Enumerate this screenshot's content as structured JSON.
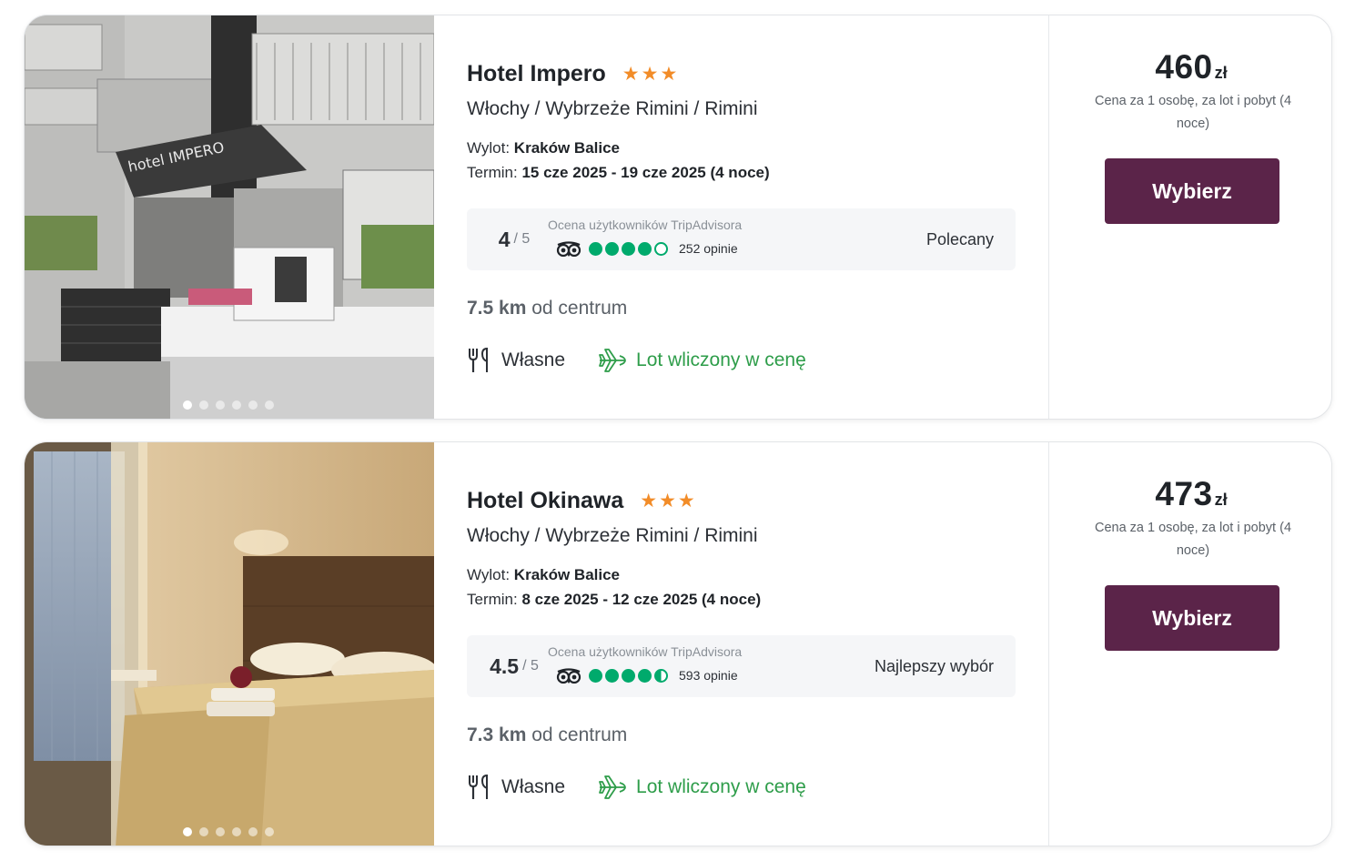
{
  "offers": [
    {
      "name": "Hotel Impero",
      "stars": 3,
      "location": "Włochy / Wybrzeże Rimini / Rimini",
      "departure_label": "Wylot: ",
      "departure_value": "Kraków Balice",
      "term_label": "Termin: ",
      "term_value": "15 cze 2025 - 19 cze 2025 (4 noce)",
      "rating": {
        "score": "4",
        "max": "/ 5",
        "label": "Ocena użytkowników TripAdvisora",
        "bubbles": 4,
        "reviews": "252 opinie",
        "badge": "Polecany"
      },
      "distance_value": "7.5 km",
      "distance_suffix": " od centrum",
      "meal": "Własne",
      "flight": "Lot wliczony w cenę",
      "price": "460",
      "currency": "zł",
      "price_note": "Cena za 1 osobę, za lot i pobyt (4 noce)",
      "cta": "Wybierz",
      "photo_dots": 6,
      "photo_active_dot": 0
    },
    {
      "name": "Hotel Okinawa",
      "stars": 3,
      "location": "Włochy / Wybrzeże Rimini / Rimini",
      "departure_label": "Wylot: ",
      "departure_value": "Kraków Balice",
      "term_label": "Termin: ",
      "term_value": "8 cze 2025 - 12 cze 2025 (4 noce)",
      "rating": {
        "score": "4.5",
        "max": "/ 5",
        "label": "Ocena użytkowników TripAdvisora",
        "bubbles": 4.5,
        "reviews": "593 opinie",
        "badge": "Najlepszy wybór"
      },
      "distance_value": "7.3 km",
      "distance_suffix": " od centrum",
      "meal": "Własne",
      "flight": "Lot wliczony w cenę",
      "price": "473",
      "currency": "zł",
      "price_note": "Cena za 1 osobę, za lot i pobyt (4 noce)",
      "cta": "Wybierz",
      "photo_dots": 6,
      "photo_active_dot": 0
    }
  ],
  "colors": {
    "star": "#f28c28",
    "tripadvisor_green": "#00aa6c",
    "flight_green": "#2e9d4a",
    "cta": "#5b2449"
  },
  "icons": {
    "star": "star-icon",
    "tripadvisor": "tripadvisor-owl-icon",
    "meal": "cutlery-icon",
    "flight": "airplane-icon"
  }
}
